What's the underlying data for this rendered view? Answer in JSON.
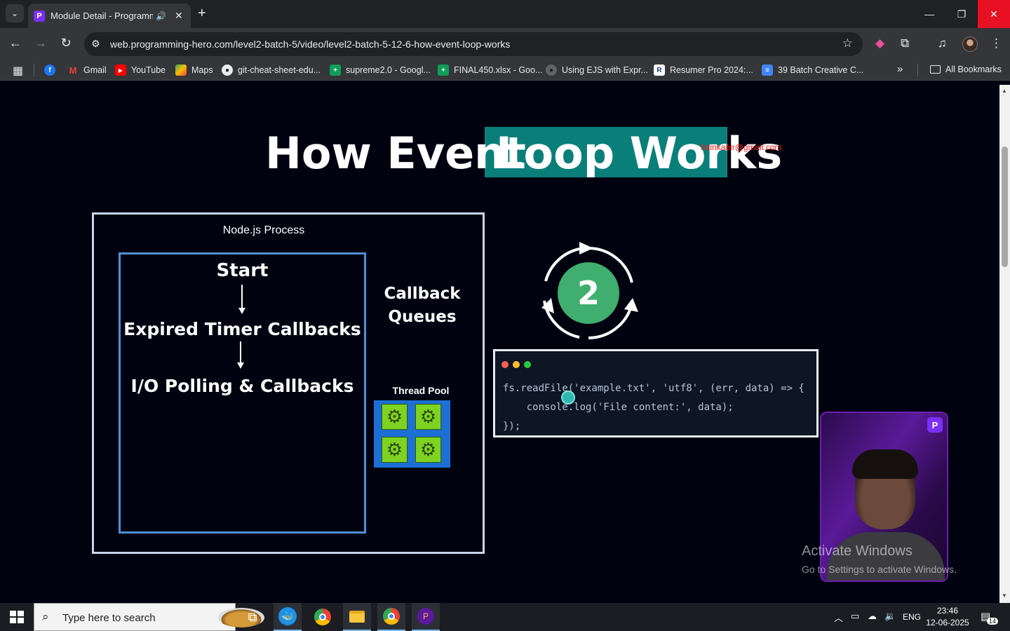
{
  "browser": {
    "tab": {
      "title": "Module Detail - Programming Hero"
    },
    "address_url": "web.programming-hero.com/level2-batch-5/video/level2-batch-5-12-6-how-event-loop-works",
    "bookmarks": [
      {
        "label": "",
        "icon": "facebook-icon",
        "color": "#1877f2"
      },
      {
        "label": "Gmail",
        "icon": "gmail-icon",
        "color": "#ea4335"
      },
      {
        "label": "YouTube",
        "icon": "youtube-icon",
        "color": "#ff0000"
      },
      {
        "label": "Maps",
        "icon": "maps-icon",
        "color": "#34a853"
      },
      {
        "label": "git-cheat-sheet-edu...",
        "icon": "github-icon",
        "color": "#e8eaed"
      },
      {
        "label": "supreme2.0 - Googl...",
        "icon": "sheets-icon",
        "color": "#0f9d58"
      },
      {
        "label": "FINAL450.xlsx - Goo...",
        "icon": "sheets-icon",
        "color": "#0f9d58"
      },
      {
        "label": "Using EJS with Expr...",
        "icon": "github-icon",
        "color": "#e8eaed"
      },
      {
        "label": "Resumer Pro 2024:...",
        "icon": "resumer-icon",
        "color": "#ffffff"
      },
      {
        "label": "39 Batch Creative C...",
        "icon": "docs-icon",
        "color": "#4285f4"
      }
    ],
    "all_bookmarks": "All Bookmarks"
  },
  "slide": {
    "title_part1": "How Event",
    "title_part2": "Loop Works",
    "email_watermark": "fatinkabir@gmail.com",
    "process_label": "Node.js Process",
    "phases": [
      "Start",
      "Expired Timer Callbacks",
      "I/O Polling & Callbacks"
    ],
    "callback_queues": [
      "Callback",
      "Queues"
    ],
    "thread_pool_label": "Thread Pool",
    "loop_number": "2",
    "code": {
      "line1": "fs.readFile('example.txt', 'utf8', (err, data) => {",
      "line2": "    console.log('File content:', data);",
      "line3": "});"
    },
    "accent_color": "#0a7f7a"
  },
  "overlay": {
    "activate_title": "Activate Windows",
    "activate_sub": "Go to Settings to activate Windows."
  },
  "taskbar": {
    "search_placeholder": "Type here to search",
    "language": "ENG",
    "time": "23:46",
    "date": "12-06-2025",
    "notifications": "14"
  }
}
